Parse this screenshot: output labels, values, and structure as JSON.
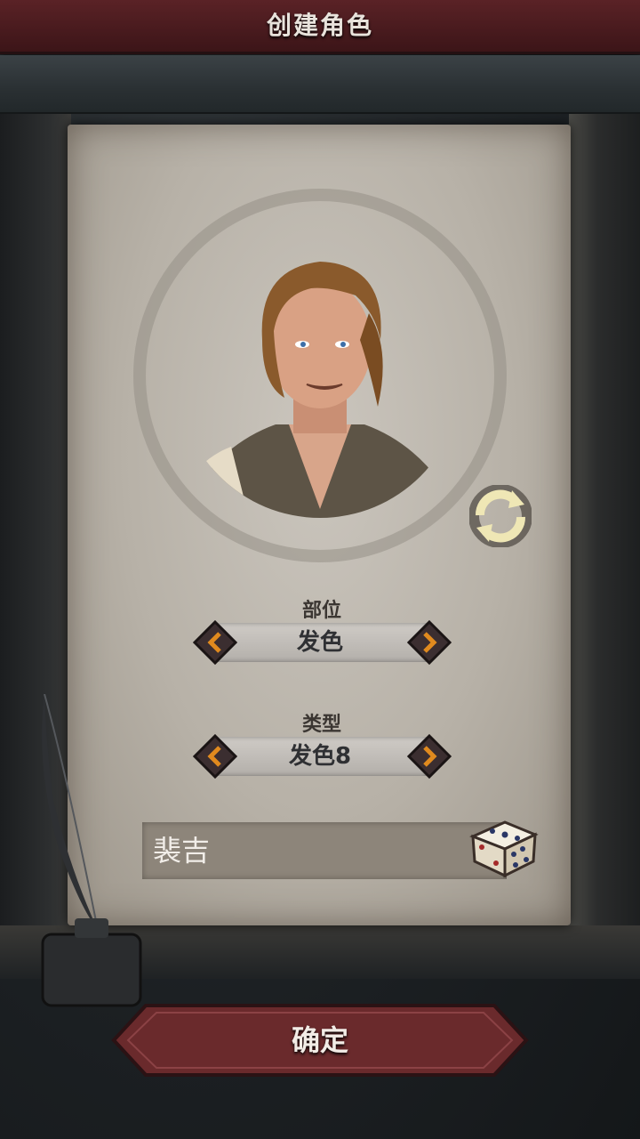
{
  "header": {
    "title": "创建角色"
  },
  "portrait": {
    "refresh_icon": "refresh-icon"
  },
  "part_selector": {
    "label": "部位",
    "value": "发色",
    "prev_icon": "chevron-left-icon",
    "next_icon": "chevron-right-icon"
  },
  "type_selector": {
    "label": "类型",
    "value": "发色8",
    "prev_icon": "chevron-left-icon",
    "next_icon": "chevron-right-icon"
  },
  "name": {
    "value": "裴吉",
    "dice_icon": "dice-icon"
  },
  "footer": {
    "confirm_label": "确定"
  },
  "colors": {
    "accent": "#6a2a2c",
    "arrow": "#e08a1e"
  }
}
